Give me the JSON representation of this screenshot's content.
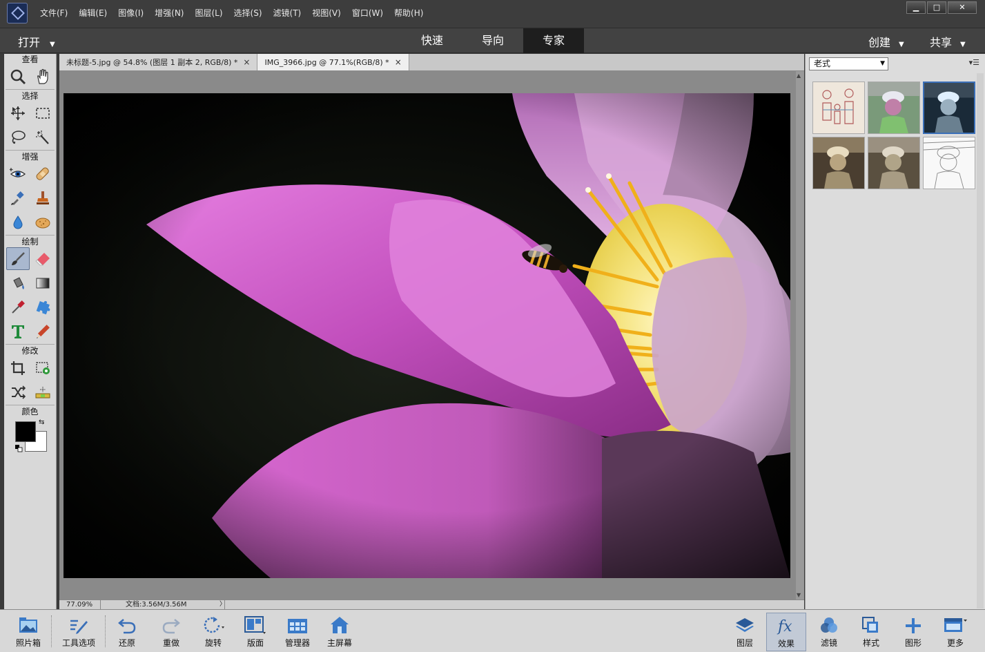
{
  "menu": [
    "文件(F)",
    "编辑(E)",
    "图像(I)",
    "增强(N)",
    "图层(L)",
    "选择(S)",
    "滤镜(T)",
    "视图(V)",
    "窗口(W)",
    "帮助(H)"
  ],
  "window_controls": {
    "minimize": "▁",
    "maximize": "□",
    "close": "✕"
  },
  "modebar": {
    "open_label": "打开",
    "tabs": [
      {
        "label": "快速"
      },
      {
        "label": "导向"
      },
      {
        "label": "专家"
      }
    ],
    "active_tab": "专家",
    "create_label": "创建",
    "share_label": "共享"
  },
  "toolbox": {
    "sections": {
      "view": "查看",
      "select": "选择",
      "enhance": "增强",
      "draw": "绘制",
      "modify": "修改",
      "color": "颜色"
    },
    "foreground_color": "#000000",
    "background_color": "#ffffff"
  },
  "document_tabs": [
    {
      "title": "未标题-5.jpg @ 54.8% (图层 1 副本 2, RGB/8) *",
      "close": "×"
    },
    {
      "title": "IMG_3966.jpg @ 77.1%(RGB/8) *",
      "close": "×"
    }
  ],
  "status": {
    "zoom": "77.09%",
    "doc_info": "文档:3.56M/3.56M",
    "arrow": "〉"
  },
  "effects_panel": {
    "category": "老式",
    "selected_index": 2,
    "thumbnails": [
      "sketch-color",
      "tinted-green",
      "blue-dark",
      "sepia-warm",
      "sepia-soft",
      "pencil-sketch"
    ]
  },
  "bottombar": {
    "left": [
      {
        "label": "照片箱",
        "icon": "photo-bin-icon"
      },
      {
        "label": "工具选项",
        "icon": "tool-options-icon"
      },
      {
        "label": "还原",
        "icon": "undo-icon"
      },
      {
        "label": "重做",
        "icon": "redo-icon"
      },
      {
        "label": "旋转",
        "icon": "rotate-icon"
      },
      {
        "label": "版面",
        "icon": "layout-icon"
      },
      {
        "label": "管理器",
        "icon": "organizer-icon"
      },
      {
        "label": "主屏幕",
        "icon": "home-icon"
      }
    ],
    "right": [
      {
        "label": "图层",
        "icon": "layers-icon"
      },
      {
        "label": "效果",
        "icon": "effects-icon"
      },
      {
        "label": "滤镜",
        "icon": "filters-icon"
      },
      {
        "label": "样式",
        "icon": "styles-icon"
      },
      {
        "label": "图形",
        "icon": "graphics-icon"
      },
      {
        "label": "更多",
        "icon": "more-icon"
      }
    ]
  },
  "colors": {
    "accent": "#3a6fb8",
    "active_mode_tab": "#1e1e1e",
    "toolbar_bg": "#d8d8d8"
  }
}
